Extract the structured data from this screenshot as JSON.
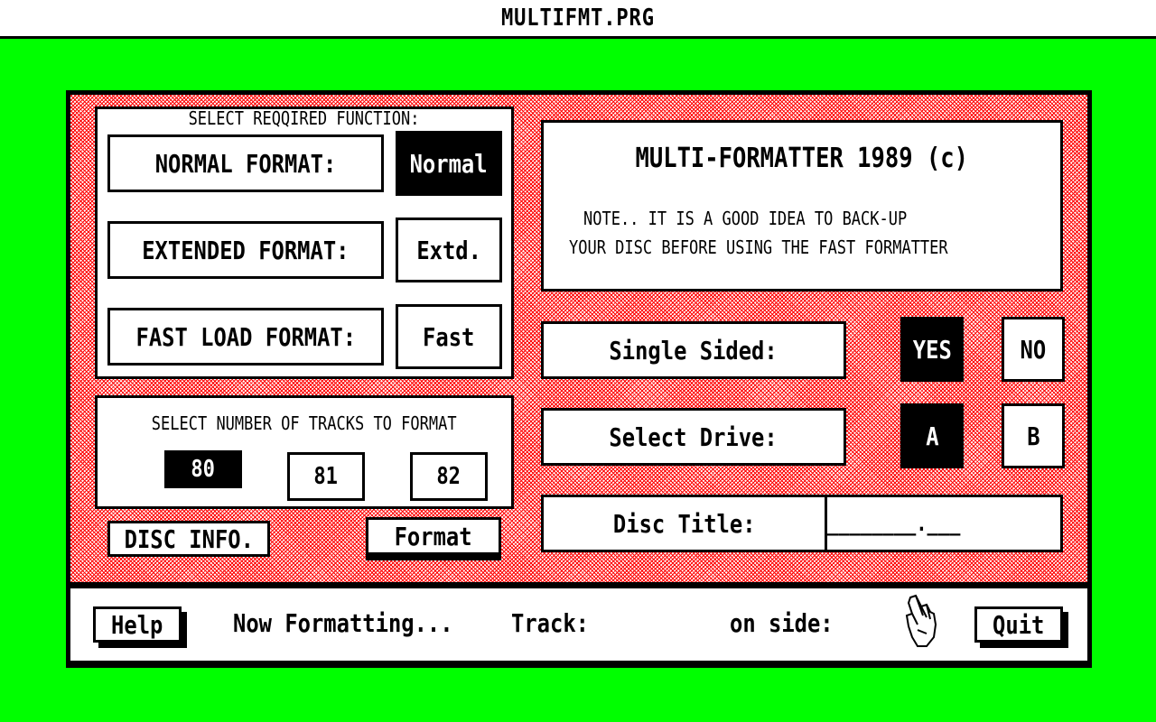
{
  "window_title": "MULTIFMT.PRG",
  "function_panel": {
    "heading": "SELECT REQQIRED FUNCTION:",
    "normal_label": "NORMAL FORMAT:",
    "normal_button": "Normal",
    "extended_label": "EXTENDED FORMAT:",
    "extended_button": "Extd.",
    "fast_label": "FAST LOAD FORMAT:",
    "fast_button": "Fast",
    "selected": "Normal"
  },
  "tracks_panel": {
    "heading": "SELECT NUMBER OF TRACKS TO FORMAT",
    "options": [
      "80",
      "81",
      "82"
    ],
    "selected": "80"
  },
  "actions": {
    "disc_info": "DISC INFO.",
    "format": "Format"
  },
  "info_panel": {
    "title": "MULTI-FORMATTER 1989 (c)",
    "note_line1": "NOTE.. IT IS A GOOD IDEA TO BACK-UP",
    "note_line2": "YOUR DISC BEFORE USING THE FAST FORMATTER"
  },
  "sides": {
    "label": "Single Sided:",
    "yes": "YES",
    "no": "NO",
    "selected": "YES"
  },
  "drive": {
    "label": "Select Drive:",
    "a": "A",
    "b": "B",
    "selected": "A"
  },
  "disc_title": {
    "label": "Disc Title:",
    "value": "________.___"
  },
  "status": {
    "help": "Help",
    "formatting": "Now Formatting...",
    "track": "Track:",
    "on_side": "on side:",
    "cursor_icon": "pointing-hand-icon",
    "quit": "Quit"
  },
  "colors": {
    "desktop": "#00ff00",
    "pattern": "#ff0000"
  }
}
